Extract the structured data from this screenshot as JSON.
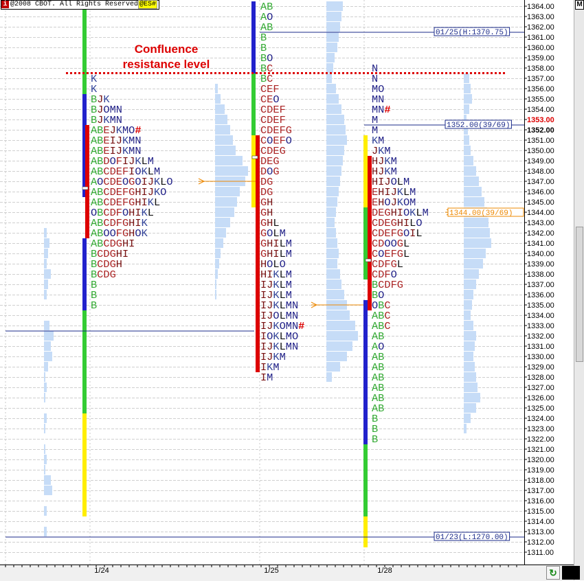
{
  "copyright": {
    "badge": "i",
    "text": "@2008 CBOT. All Rights Reserved",
    "symbol": "@ES#"
  },
  "corner_button": "M",
  "refresh_icon": "refresh-icon",
  "annotation": {
    "line1": "Confluence",
    "line2": "resistance level",
    "color": "#dd0000"
  },
  "price_axis": {
    "min": 1311,
    "max": 1364,
    "step": 1,
    "highlight_red": "1353.00",
    "highlight_black": "1352.00"
  },
  "reference_lines": [
    {
      "label": "01/25(H:1370.75)",
      "price": 1361
    },
    {
      "label": "1352.00(39/69)",
      "price": 1352
    },
    {
      "label": "01/23(L:1270.00)",
      "price": 1312
    }
  ],
  "orange_label": "1344.00(39/69)",
  "dates": [
    "1/24",
    "1/25",
    "1/28"
  ],
  "chart_data": {
    "type": "market-profile",
    "title": "",
    "y_unit": "price",
    "ylim": [
      1311,
      1364
    ],
    "resistance_level": 1357.5,
    "sessions": [
      {
        "date": "1/24",
        "profile_high": 1357,
        "profile_low": 1336,
        "poc": 1347,
        "rows": [
          {
            "price": 1357,
            "letters": "K"
          },
          {
            "price": 1356,
            "letters": "K"
          },
          {
            "price": 1355,
            "letters": "BJK"
          },
          {
            "price": 1354,
            "letters": "BJOMN"
          },
          {
            "price": 1353,
            "letters": "BJKMN"
          },
          {
            "price": 1352,
            "letters": "ABEJKMO#"
          },
          {
            "price": 1351,
            "letters": "ABEIJKMN"
          },
          {
            "price": 1350,
            "letters": "ABEIJKMN"
          },
          {
            "price": 1349,
            "letters": "ABDOFIJKLM"
          },
          {
            "price": 1348,
            "letters": "ABCDEFIOKLM"
          },
          {
            "price": 1347,
            "letters": "AOCDEOGOIJKLO"
          },
          {
            "price": 1346,
            "letters": "ABCDEFGHIJKO"
          },
          {
            "price": 1345,
            "letters": "ABCDEFGHIKL"
          },
          {
            "price": 1344,
            "letters": "OBCDFOHIKL"
          },
          {
            "price": 1343,
            "letters": "ABCDFGHIK"
          },
          {
            "price": 1342,
            "letters": "ABOOFGHOK"
          },
          {
            "price": 1341,
            "letters": "ABCDGHI"
          },
          {
            "price": 1340,
            "letters": "BCDGHI"
          },
          {
            "price": 1339,
            "letters": "BCDGH"
          },
          {
            "price": 1338,
            "letters": "BCDG"
          },
          {
            "price": 1337,
            "letters": "B"
          },
          {
            "price": 1336,
            "letters": "B"
          },
          {
            "price": 1335,
            "letters": "B"
          }
        ]
      },
      {
        "date": "1/25",
        "profile_high": 1364,
        "profile_low": 1328,
        "poc": 1335,
        "rows": [
          {
            "price": 1364,
            "letters": "AB"
          },
          {
            "price": 1363,
            "letters": "AO"
          },
          {
            "price": 1362,
            "letters": "AB"
          },
          {
            "price": 1361,
            "letters": "B"
          },
          {
            "price": 1360,
            "letters": "B"
          },
          {
            "price": 1359,
            "letters": "BO"
          },
          {
            "price": 1358,
            "letters": "BC"
          },
          {
            "price": 1357,
            "letters": "BC"
          },
          {
            "price": 1356,
            "letters": "CEF"
          },
          {
            "price": 1355,
            "letters": "CEO"
          },
          {
            "price": 1354,
            "letters": "CDEF"
          },
          {
            "price": 1353,
            "letters": "CDEF"
          },
          {
            "price": 1352,
            "letters": "CDEFG"
          },
          {
            "price": 1351,
            "letters": "COEFO"
          },
          {
            "price": 1350,
            "letters": "CDEG"
          },
          {
            "price": 1349,
            "letters": "DEG"
          },
          {
            "price": 1348,
            "letters": "DOG"
          },
          {
            "price": 1347,
            "letters": "DG"
          },
          {
            "price": 1346,
            "letters": "DG"
          },
          {
            "price": 1345,
            "letters": "GH"
          },
          {
            "price": 1344,
            "letters": "GH"
          },
          {
            "price": 1343,
            "letters": "GHL"
          },
          {
            "price": 1342,
            "letters": "GOLM"
          },
          {
            "price": 1341,
            "letters": "GHILM"
          },
          {
            "price": 1340,
            "letters": "GHILM"
          },
          {
            "price": 1339,
            "letters": "HOLO"
          },
          {
            "price": 1338,
            "letters": "HIKLM"
          },
          {
            "price": 1337,
            "letters": "IJKLM"
          },
          {
            "price": 1336,
            "letters": "IJKLM"
          },
          {
            "price": 1335,
            "letters": "IJKLMN"
          },
          {
            "price": 1334,
            "letters": "IJOLMN"
          },
          {
            "price": 1333,
            "letters": "IJKOMN#"
          },
          {
            "price": 1332,
            "letters": "IOKLMO"
          },
          {
            "price": 1331,
            "letters": "IJKLMN"
          },
          {
            "price": 1330,
            "letters": "IJKM"
          },
          {
            "price": 1329,
            "letters": "IKM"
          },
          {
            "price": 1328,
            "letters": "IM"
          }
        ]
      },
      {
        "date": "1/28",
        "profile_high": 1358,
        "profile_low": 1322,
        "poc": 1344,
        "rows": [
          {
            "price": 1358,
            "letters": "N"
          },
          {
            "price": 1357,
            "letters": "N"
          },
          {
            "price": 1356,
            "letters": "MO"
          },
          {
            "price": 1355,
            "letters": "MN"
          },
          {
            "price": 1354,
            "letters": "MN#"
          },
          {
            "price": 1353,
            "letters": "M"
          },
          {
            "price": 1352,
            "letters": "M"
          },
          {
            "price": 1351,
            "letters": "KM"
          },
          {
            "price": 1350,
            "letters": "JKM"
          },
          {
            "price": 1349,
            "letters": "HJKM"
          },
          {
            "price": 1348,
            "letters": "HJKM"
          },
          {
            "price": 1347,
            "letters": "HIJOLM"
          },
          {
            "price": 1346,
            "letters": "EHIJKLM"
          },
          {
            "price": 1345,
            "letters": "EHOJKOM"
          },
          {
            "price": 1344,
            "letters": "DEGHIOKLM"
          },
          {
            "price": 1343,
            "letters": "CDEGHILO"
          },
          {
            "price": 1342,
            "letters": "CDEFGOIL"
          },
          {
            "price": 1341,
            "letters": "CDOOGL"
          },
          {
            "price": 1340,
            "letters": "COEFGL"
          },
          {
            "price": 1339,
            "letters": "CDFGL"
          },
          {
            "price": 1338,
            "letters": "CDFO"
          },
          {
            "price": 1337,
            "letters": "BCDFG"
          },
          {
            "price": 1336,
            "letters": "BO"
          },
          {
            "price": 1335,
            "letters": "OBC"
          },
          {
            "price": 1334,
            "letters": "ABC"
          },
          {
            "price": 1333,
            "letters": "ABC"
          },
          {
            "price": 1332,
            "letters": "AB"
          },
          {
            "price": 1331,
            "letters": "AO"
          },
          {
            "price": 1330,
            "letters": "AB"
          },
          {
            "price": 1329,
            "letters": "AB"
          },
          {
            "price": 1328,
            "letters": "AB"
          },
          {
            "price": 1327,
            "letters": "AB"
          },
          {
            "price": 1326,
            "letters": "AB"
          },
          {
            "price": 1325,
            "letters": "AB"
          },
          {
            "price": 1324,
            "letters": "B"
          },
          {
            "price": 1323,
            "letters": "B"
          },
          {
            "price": 1322,
            "letters": "B"
          }
        ]
      }
    ]
  }
}
